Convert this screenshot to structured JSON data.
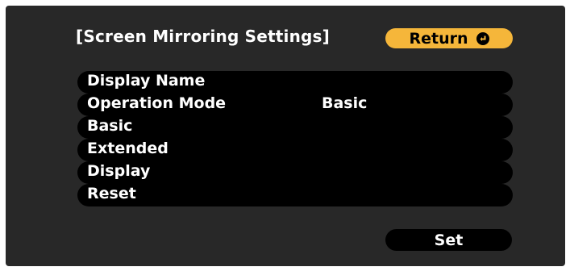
{
  "header": {
    "title": "[Screen Mirroring Settings]",
    "return_label": "Return",
    "return_icon": "enter-icon"
  },
  "menu": {
    "items": [
      {
        "label": "Display Name",
        "value": ""
      },
      {
        "label": "Operation Mode",
        "value": "Basic"
      },
      {
        "label": "Basic",
        "value": ""
      },
      {
        "label": "Extended",
        "value": ""
      },
      {
        "label": "Display",
        "value": ""
      },
      {
        "label": "Reset",
        "value": ""
      }
    ]
  },
  "footer": {
    "set_label": "Set"
  },
  "colors": {
    "panel_background": "#282828",
    "row_background": "#000000",
    "accent": "#f5b63a",
    "text": "#ffffff"
  }
}
